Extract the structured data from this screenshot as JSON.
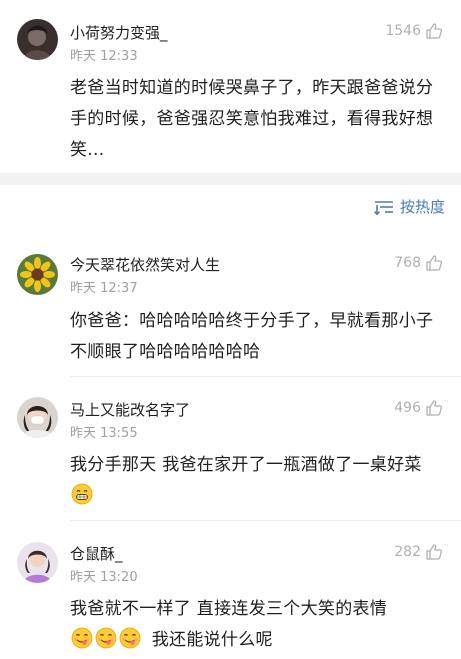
{
  "top_comment": {
    "username": "小荷努力变强_",
    "time": "昨天 12:33",
    "likes": "1546",
    "text": "老爸当时知道的时候哭鼻子了，昨天跟爸爸说分手的时候，爸爸强忍笑意怕我难过，看得我好想笑..."
  },
  "sort": {
    "label": "按热度",
    "icon": "sort-icon"
  },
  "comments": [
    {
      "username": "今天翠花依然笑对人生",
      "time": "昨天 12:37",
      "likes": "768",
      "text": "你爸爸：哈哈哈哈哈终于分手了，早就看那小子不顺眼了哈哈哈哈哈哈哈"
    },
    {
      "username": "马上又能改名字了",
      "time": "昨天 13:55",
      "likes": "496",
      "text": "我分手那天 我爸在家开了一瓶酒做了一桌好菜",
      "emoji": "grin-emoji"
    },
    {
      "username": "仓鼠酥_",
      "time": "昨天 13:20",
      "likes": "282",
      "text_a": "我爸就不一样了 直接连发三个大笑的表情",
      "text_b": "我还能说什么呢",
      "emoji": "yum-emoji"
    }
  ],
  "colors": {
    "accent": "#4a7bb7",
    "muted": "#a0a0a0",
    "separator": "#f2f2f2"
  }
}
